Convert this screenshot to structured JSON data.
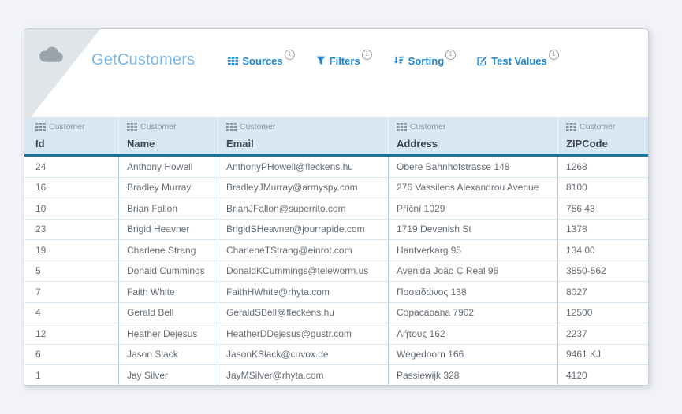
{
  "header": {
    "title": "GetCustomers",
    "menu": [
      {
        "label": "Sources",
        "icon": "sources-grid-icon",
        "badge": "1"
      },
      {
        "label": "Filters",
        "icon": "filter-funnel-icon",
        "badge": "1"
      },
      {
        "label": "Sorting",
        "icon": "sort-icon",
        "badge": "1"
      },
      {
        "label": "Test Values",
        "icon": "edit-icon",
        "badge": "1"
      }
    ]
  },
  "table": {
    "source_label": "Customer",
    "columns": [
      "Id",
      "Name",
      "Email",
      "Address",
      "ZIPCode"
    ],
    "rows": [
      [
        "24",
        "Anthony Howell",
        "AnthonyPHowell@fleckens.hu",
        "Obere Bahnhofstrasse 148",
        "1268"
      ],
      [
        "16",
        "Bradley Murray",
        "BradleyJMurray@armyspy.com",
        "276 Vassileos Alexandrou Avenue",
        "8100"
      ],
      [
        "10",
        "Brian Fallon",
        "BrianJFallon@superrito.com",
        "Příční 1029",
        "756 43"
      ],
      [
        "23",
        "Brigid Heavner",
        "BrigidSHeavner@jourrapide.com",
        "1719 Devenish St",
        "1378"
      ],
      [
        "19",
        "Charlene Strang",
        "CharleneTStrang@einrot.com",
        "Hantverkarg 95",
        "134 00"
      ],
      [
        "5",
        "Donald Cummings",
        "DonaldKCummings@teleworm.us",
        "Avenida João C Real 96",
        "3850-562"
      ],
      [
        "7",
        "Faith White",
        "FaithHWhite@rhyta.com",
        "Ποσειδώνος 138",
        "8027"
      ],
      [
        "4",
        "Gerald Bell",
        "GeraldSBell@fleckens.hu",
        "Copacabana 7902",
        "12500"
      ],
      [
        "12",
        "Heather Dejesus",
        "HeatherDDejesus@gustr.com",
        "Λήτους 162",
        "2237"
      ],
      [
        "6",
        "Jason Slack",
        "JasonKSlack@cuvox.de",
        "Wegedoorn 166",
        "9461 KJ"
      ],
      [
        "1",
        "Jay Silver",
        "JayMSilver@rhyta.com",
        "Passiewijk 328",
        "4120"
      ]
    ]
  },
  "colors": {
    "accent_blue": "#1e86d1",
    "title_blue": "#7ab7e6",
    "header_bg": "#d9e7f4",
    "header_border": "#1f729f",
    "page_bg": "#f1f3f6",
    "fold": "#dfe5e9",
    "cloud": "#98a3ac"
  }
}
